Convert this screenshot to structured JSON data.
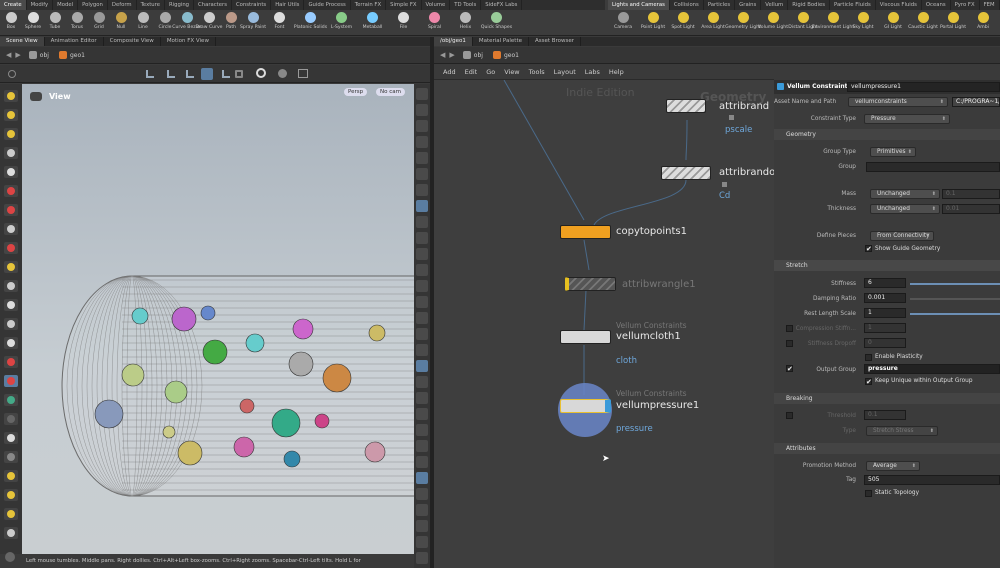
{
  "shelf": {
    "left_tabs": [
      "Create",
      "Modify",
      "Model",
      "Polygon",
      "Deform",
      "Texture",
      "Rigging",
      "Characters",
      "Constraints",
      "Hair Utils",
      "Guide Process",
      "Terrain FX",
      "Simple FX",
      "Volume",
      "TD Tools",
      "SideFX Labs"
    ],
    "right_tabs": [
      "Lights and Cameras",
      "Collisions",
      "Particles",
      "Grains",
      "Vellum",
      "Rigid Bodies",
      "Particle Fluids",
      "Viscous Fluids",
      "Oceans",
      "Pyro FX",
      "FEM",
      "Wires",
      "Cr"
    ],
    "left_tools": [
      "Box",
      "Sphere",
      "Tube",
      "Torus",
      "Grid",
      "Null",
      "Line",
      "Circle",
      "Curve Bezier",
      "Draw Curve",
      "Path",
      "Spray Paint",
      "Font",
      "Platonic Solids",
      "L-System",
      "Metaball",
      "File",
      "Spiral",
      "Helix",
      "Quick Shapes"
    ],
    "right_tools": [
      "Camera",
      "Point Light",
      "Spot Light",
      "Area Light",
      "Geometry Light",
      "Volume Light",
      "Distant Light",
      "Environment Light",
      "Sky Light",
      "GI Light",
      "Caustic Light",
      "Portal Light",
      "Ambi"
    ]
  },
  "left_pane": {
    "tabs": [
      "Scene View",
      "Animation Editor",
      "Composite View",
      "Motion FX View"
    ],
    "path": [
      "obj",
      "geo1"
    ],
    "view_label": "View",
    "persp_btn": "Persp",
    "cam_btn": "No cam",
    "status": "Left mouse tumbles. Middle pans. Right dollies. Ctrl+Alt+Left box-zooms. Ctrl+Right zooms. Spacebar-Ctrl-Left tilts. Hold L for"
  },
  "right_pane": {
    "tabs": [
      "/obj/geo1",
      "Material Palette",
      "Asset Browser"
    ],
    "path": [
      "obj",
      "geo1"
    ],
    "menu": [
      "Add",
      "Edit",
      "Go",
      "View",
      "Tools",
      "Layout",
      "Labs",
      "Help"
    ],
    "watermark": "Indie Edition",
    "context": "Geometry"
  },
  "nodes": {
    "attribrand1": {
      "name": "attribrand",
      "sub": "pscale"
    },
    "attribrando2": {
      "name": "attribrando",
      "sub": "Cd"
    },
    "copytopoints": {
      "name": "copytopoints1"
    },
    "attribwrangle": {
      "name": "attribwrangle1"
    },
    "vellumcloth": {
      "type": "Vellum Constraints",
      "name": "vellumcloth1",
      "sub": "cloth"
    },
    "vellumpressure": {
      "type": "Vellum Constraints",
      "name": "vellumpressure1",
      "sub": "pressure"
    }
  },
  "params": {
    "node_type": "Vellum Constraints",
    "node_name": "vellumpressure1",
    "asset_label": "Asset Name and Path",
    "asset_value": "vellumconstraints",
    "asset_path": "C:/PROGRA~1/S",
    "ctype_label": "Constraint Type",
    "ctype_value": "Pressure",
    "sec_geometry": "Geometry",
    "grouptype_label": "Group Type",
    "grouptype_value": "Primitives",
    "group_label": "Group",
    "mass_label": "Mass",
    "mass_value": "Unchanged",
    "mass_num": "0.1",
    "thick_label": "Thickness",
    "thick_value": "Unchanged",
    "thick_num": "0.01",
    "pieces_label": "Define Pieces",
    "pieces_value": "From Connectivity",
    "guide_label": "Show Guide Geometry",
    "sec_stretch": "Stretch",
    "stiff_label": "Stiffness",
    "stiff_value": "6",
    "damp_label": "Damping Ratio",
    "damp_value": "0.001",
    "rest_label": "Rest Length Scale",
    "rest_value": "1",
    "comp_label": "Compression Stiffn...",
    "comp_value": "1",
    "drop_label": "Stiffness Dropoff",
    "drop_value": "0",
    "plastic_label": "Enable Plasticity",
    "outgrp_label": "Output Group",
    "outgrp_value": "pressure",
    "unique_label": "Keep Unique within Output Group",
    "sec_breaking": "Breaking",
    "thresh_label": "Threshold",
    "thresh_value": "0.1",
    "btype_label": "Type",
    "btype_value": "Stretch Stress",
    "sec_attributes": "Attributes",
    "promo_label": "Promotion Method",
    "promo_value": "Average",
    "tag_label": "Tag",
    "tag_value": "505",
    "static_label": "Static Topology"
  }
}
